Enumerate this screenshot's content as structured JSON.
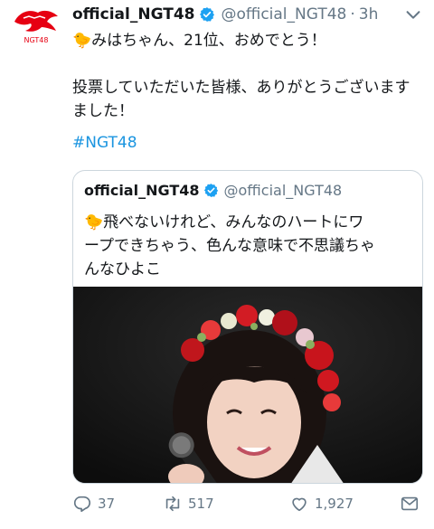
{
  "tweet": {
    "display_name": "official_NGT48",
    "handle": "@official_NGT48",
    "separator": "·",
    "time": "3h",
    "text_lines": [
      "🐤みはちゃん、21位、おめでとう！",
      "",
      "投票していただいた皆様、ありがとうございます",
      "ました！"
    ],
    "hashtag": "#NGT48"
  },
  "quoted": {
    "display_name": "official_NGT48",
    "handle": "@official_NGT48",
    "text_lines": [
      "🐤飛べないけれど、みんなのハートにワ",
      "ープできちゃう、色んな意味で不思議ちゃ",
      "んなひよこ"
    ]
  },
  "actions": {
    "reply_count": "37",
    "retweet_count": "517",
    "like_count": "1,927"
  },
  "colors": {
    "text": "#14171a",
    "secondary": "#657786",
    "link": "#1b95e0",
    "verified": "#1da1f2",
    "logo_red": "#e60012"
  },
  "icons": {
    "avatar": "ngt48-logo",
    "verified": "verified-badge-icon",
    "menu": "chevron-down-icon",
    "reply": "reply-icon",
    "retweet": "retweet-icon",
    "like": "heart-icon",
    "dm": "envelope-icon"
  }
}
